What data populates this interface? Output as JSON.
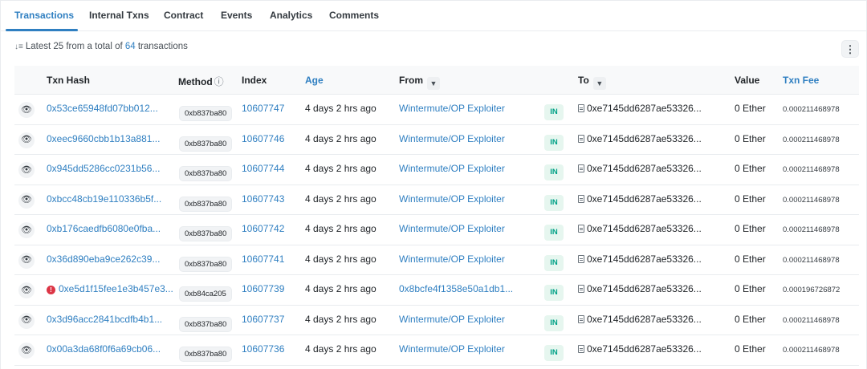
{
  "tabs": [
    {
      "label": "Transactions",
      "active": true
    },
    {
      "label": "Internal Txns",
      "active": false
    },
    {
      "label": "Contract",
      "active": false
    },
    {
      "label": "Events",
      "active": false
    },
    {
      "label": "Analytics",
      "active": false
    },
    {
      "label": "Comments",
      "active": false
    }
  ],
  "summary": {
    "sort_icon": "sort-descending-icon",
    "prefix": "Latest 25 from a total of ",
    "count": "64",
    "suffix": " transactions"
  },
  "more_button": {
    "icon": "vertical-dots-icon",
    "glyph": "⋮"
  },
  "columns": {
    "txn_hash": "Txn Hash",
    "method": "Method",
    "method_info": "ⓘ",
    "index": "Index",
    "age": "Age",
    "from": "From",
    "to": "To",
    "value": "Value",
    "txn_fee": "Txn Fee"
  },
  "colors": {
    "accent": "#2f7fc1",
    "in_badge_bg": "#e6f6ef",
    "in_badge_text": "#00a186",
    "error": "#dc3545"
  },
  "rows": [
    {
      "hash": "0x53ce65948fd07bb012...",
      "error": false,
      "method": "0xb837ba80",
      "index": "10607747",
      "age": "4 days 2 hrs ago",
      "from": "Wintermute/OP Exploiter",
      "direction": "IN",
      "to": "0xe7145dd6287ae53326...",
      "value": "0 Ether",
      "fee": "0.000211468978"
    },
    {
      "hash": "0xeec9660cbb1b13a881...",
      "error": false,
      "method": "0xb837ba80",
      "index": "10607746",
      "age": "4 days 2 hrs ago",
      "from": "Wintermute/OP Exploiter",
      "direction": "IN",
      "to": "0xe7145dd6287ae53326...",
      "value": "0 Ether",
      "fee": "0.000211468978"
    },
    {
      "hash": "0x945dd5286cc0231b56...",
      "error": false,
      "method": "0xb837ba80",
      "index": "10607744",
      "age": "4 days 2 hrs ago",
      "from": "Wintermute/OP Exploiter",
      "direction": "IN",
      "to": "0xe7145dd6287ae53326...",
      "value": "0 Ether",
      "fee": "0.000211468978"
    },
    {
      "hash": "0xbcc48cb19e110336b5f...",
      "error": false,
      "method": "0xb837ba80",
      "index": "10607743",
      "age": "4 days 2 hrs ago",
      "from": "Wintermute/OP Exploiter",
      "direction": "IN",
      "to": "0xe7145dd6287ae53326...",
      "value": "0 Ether",
      "fee": "0.000211468978"
    },
    {
      "hash": "0xb176caedfb6080e0fba...",
      "error": false,
      "method": "0xb837ba80",
      "index": "10607742",
      "age": "4 days 2 hrs ago",
      "from": "Wintermute/OP Exploiter",
      "direction": "IN",
      "to": "0xe7145dd6287ae53326...",
      "value": "0 Ether",
      "fee": "0.000211468978"
    },
    {
      "hash": "0x36d890eba9ce262c39...",
      "error": false,
      "method": "0xb837ba80",
      "index": "10607741",
      "age": "4 days 2 hrs ago",
      "from": "Wintermute/OP Exploiter",
      "direction": "IN",
      "to": "0xe7145dd6287ae53326...",
      "value": "0 Ether",
      "fee": "0.000211468978"
    },
    {
      "hash": "0xe5d1f15fee1e3b457e3...",
      "error": true,
      "method": "0xb84ca205",
      "index": "10607739",
      "age": "4 days 2 hrs ago",
      "from": "0x8bcfe4f1358e50a1db1...",
      "direction": "IN",
      "to": "0xe7145dd6287ae53326...",
      "value": "0 Ether",
      "fee": "0.000196726872"
    },
    {
      "hash": "0x3d96acc2841bcdfb4b1...",
      "error": false,
      "method": "0xb837ba80",
      "index": "10607737",
      "age": "4 days 2 hrs ago",
      "from": "Wintermute/OP Exploiter",
      "direction": "IN",
      "to": "0xe7145dd6287ae53326...",
      "value": "0 Ether",
      "fee": "0.000211468978"
    },
    {
      "hash": "0x00a3da68f0f6a69cb06...",
      "error": false,
      "method": "0xb837ba80",
      "index": "10607736",
      "age": "4 days 2 hrs ago",
      "from": "Wintermute/OP Exploiter",
      "direction": "IN",
      "to": "0xe7145dd6287ae53326...",
      "value": "0 Ether",
      "fee": "0.000211468978"
    }
  ]
}
